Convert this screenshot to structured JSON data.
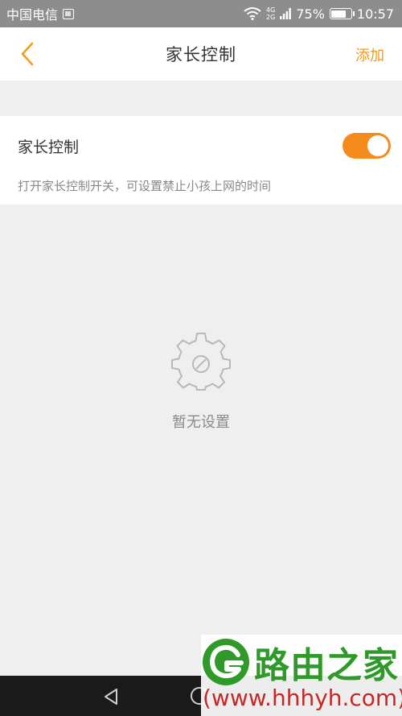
{
  "status_bar": {
    "carrier": "中国电信",
    "network_top": "4G",
    "network_bottom": "2G",
    "battery": "75%",
    "battery_level": 0.75,
    "time": "10:57"
  },
  "header": {
    "title": "家长控制",
    "add_label": "添加",
    "accent_color": "#f59a17"
  },
  "parental_control": {
    "title": "家长控制",
    "enabled": true,
    "description": "打开家长控制开关，可设置禁止小孩上网的时间",
    "toggle_color": "#f58b1c"
  },
  "empty_state": {
    "icon": "gear-disabled-icon",
    "text": "暂无设置"
  },
  "watermark": {
    "brand": "路由之家",
    "url": "(www.hhhyh.com)"
  }
}
